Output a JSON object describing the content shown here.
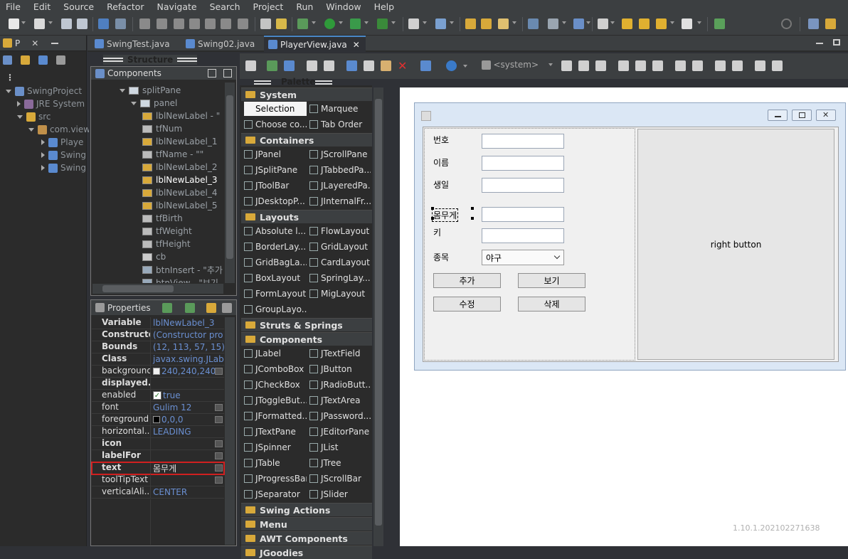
{
  "menu": [
    "File",
    "Edit",
    "Source",
    "Refactor",
    "Navigate",
    "Search",
    "Project",
    "Run",
    "Window",
    "Help"
  ],
  "package_explorer": {
    "tab_label": "P",
    "tree": [
      {
        "label": "SwingProject",
        "depth": 0,
        "expanded": true
      },
      {
        "label": "JRE System",
        "depth": 1,
        "expanded": false
      },
      {
        "label": "src",
        "depth": 1,
        "expanded": true
      },
      {
        "label": "com.view",
        "depth": 2,
        "expanded": true
      },
      {
        "label": "Playe",
        "depth": 3,
        "expanded": false
      },
      {
        "label": "Swing",
        "depth": 3,
        "expanded": false
      },
      {
        "label": "Swing",
        "depth": 3,
        "expanded": false
      }
    ]
  },
  "editor_tabs": [
    {
      "label": "SwingTest.java",
      "active": false
    },
    {
      "label": "Swing02.java",
      "active": false
    },
    {
      "label": "PlayerView.java",
      "active": true
    }
  ],
  "structure": {
    "title": "Structure",
    "components_title": "Components",
    "tree": [
      {
        "label": "splitPane",
        "depth": 0
      },
      {
        "label": "panel",
        "depth": 1
      },
      {
        "label": "lblNewLabel - \"",
        "depth": 2,
        "kind": "label"
      },
      {
        "label": "tfNum",
        "depth": 2,
        "kind": "field"
      },
      {
        "label": "lblNewLabel_1",
        "depth": 2,
        "kind": "label"
      },
      {
        "label": "tfName - \"\"",
        "depth": 2,
        "kind": "field"
      },
      {
        "label": "lblNewLabel_2",
        "depth": 2,
        "kind": "label"
      },
      {
        "label": "lblNewLabel_3",
        "depth": 2,
        "kind": "label",
        "selected": true
      },
      {
        "label": "lblNewLabel_4",
        "depth": 2,
        "kind": "label"
      },
      {
        "label": "lblNewLabel_5",
        "depth": 2,
        "kind": "label"
      },
      {
        "label": "tfBirth",
        "depth": 2,
        "kind": "field"
      },
      {
        "label": "tfWeight",
        "depth": 2,
        "kind": "field"
      },
      {
        "label": "tfHeight",
        "depth": 2,
        "kind": "field"
      },
      {
        "label": "cb",
        "depth": 2,
        "kind": "combo"
      },
      {
        "label": "btnInsert - \"추가",
        "depth": 2,
        "kind": "button"
      },
      {
        "label": "btnView - \"보기",
        "depth": 2,
        "kind": "button"
      }
    ]
  },
  "properties": {
    "title": "Properties",
    "rows": [
      {
        "key": "Variable",
        "value": "lblNewLabel_3",
        "bold": true
      },
      {
        "key": "Constructor",
        "value": "(Constructor pro",
        "bold": true,
        "expand": true
      },
      {
        "key": "Bounds",
        "value": "(12, 113, 57, 15)",
        "bold": true,
        "expand": true
      },
      {
        "key": "Class",
        "value": "javax.swing.JLabel",
        "bold": true
      },
      {
        "key": "background",
        "value": "240,240,240",
        "swatch": "#f0f0f0",
        "ellipsis": true
      },
      {
        "key": "displayed...",
        "value": "",
        "bold": true
      },
      {
        "key": "enabled",
        "value": "true",
        "checkbox": true
      },
      {
        "key": "font",
        "value": "Gulim 12",
        "ellipsis": true
      },
      {
        "key": "foreground",
        "value": "0,0,0",
        "swatch": "#000000",
        "ellipsis": true
      },
      {
        "key": "horizontal...",
        "value": "LEADING"
      },
      {
        "key": "icon",
        "value": "",
        "bold": true,
        "ellipsis": true
      },
      {
        "key": "labelFor",
        "value": "",
        "bold": true,
        "ellipsis": true
      },
      {
        "key": "text",
        "value": "몸무게",
        "bold": true,
        "ellipsis": true,
        "highlight": true
      },
      {
        "key": "toolTipText",
        "value": "",
        "ellipsis": true
      },
      {
        "key": "verticalAli...",
        "value": "CENTER"
      }
    ]
  },
  "palette": {
    "title": "Palette",
    "system_items": [
      "Selection",
      "Marquee",
      "Choose co...",
      "Tab Order"
    ],
    "categories": [
      {
        "name": "System"
      },
      {
        "name": "Containers",
        "items": [
          "JPanel",
          "JScrollPane",
          "JSplitPane",
          "JTabbedPa...",
          "JToolBar",
          "JLayeredPa...",
          "JDesktopP...",
          "JInternalFr..."
        ]
      },
      {
        "name": "Layouts",
        "items": [
          "Absolute l...",
          "FlowLayout",
          "BorderLay...",
          "GridLayout",
          "GridBagLa...",
          "CardLayout",
          "BoxLayout",
          "SpringLay...",
          "FormLayout",
          "MigLayout",
          "GroupLayo..."
        ]
      },
      {
        "name": "Struts & Springs"
      },
      {
        "name": "Components",
        "items": [
          "JLabel",
          "JTextField",
          "JComboBox",
          "JButton",
          "JCheckBox",
          "JRadioButt...",
          "JToggleBut...",
          "JTextArea",
          "JFormatted...",
          "JPassword...",
          "JTextPane",
          "JEditorPane",
          "JSpinner",
          "JList",
          "JTable",
          "JTree",
          "JProgressBar",
          "JScrollBar",
          "JSeparator",
          "JSlider"
        ]
      },
      {
        "name": "Swing Actions"
      },
      {
        "name": "Menu"
      },
      {
        "name": "AWT Components"
      },
      {
        "name": "JGoodies"
      }
    ]
  },
  "designer": {
    "system_dropdown": "<system>",
    "form": {
      "labels": [
        "번호",
        "이름",
        "생일",
        "몸무게",
        "키",
        "종목"
      ],
      "combo_value": "야구",
      "buttons": [
        "추가",
        "보기",
        "수정",
        "삭제"
      ],
      "right_button": "right button"
    }
  },
  "version": "1.10.1.202102271638",
  "colors": {
    "accent": "#4a88c7",
    "highlight_border": "#d02020",
    "link_value": "#6a8fd1"
  }
}
